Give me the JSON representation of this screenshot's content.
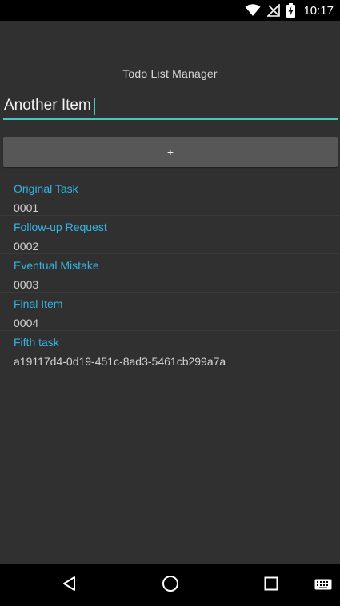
{
  "status_bar": {
    "time": "10:17",
    "icons": [
      "wifi-icon",
      "signal-off-icon",
      "battery-charging-icon"
    ]
  },
  "app": {
    "title": "Todo List Manager",
    "input": {
      "value": "Another Item",
      "placeholder": ""
    },
    "add_button_label": "+",
    "tasks": [
      {
        "title": "Original Task",
        "subtitle": "0001"
      },
      {
        "title": "Follow-up Request",
        "subtitle": "0002"
      },
      {
        "title": "Eventual Mistake",
        "subtitle": "0003"
      },
      {
        "title": "Final Item",
        "subtitle": "0004"
      },
      {
        "title": "Fifth task",
        "subtitle": "a19117d4-0d19-451c-8ad3-5461cb299a7a"
      }
    ]
  },
  "nav_bar": {
    "icons": [
      "back-icon",
      "home-icon",
      "recents-icon",
      "keyboard-icon"
    ]
  },
  "colors": {
    "accent": "#4cc6ba",
    "link": "#33b5e5",
    "background": "#303030"
  }
}
